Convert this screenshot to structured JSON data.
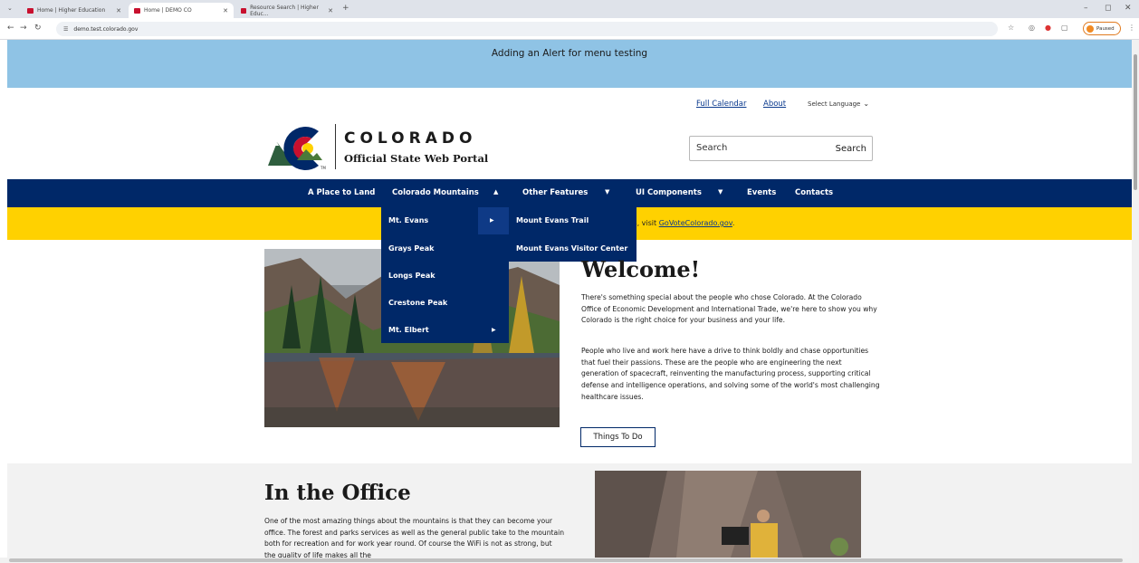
{
  "browser": {
    "tabs": [
      {
        "title": "Home | Higher Education"
      },
      {
        "title": "Home | DEMO CO"
      },
      {
        "title": "Resource Search | Higher Educ..."
      }
    ],
    "url": "demo.test.colorado.gov",
    "profile_label": "Paused",
    "icons": {
      "back": "back-arrow-icon",
      "forward": "forward-arrow-icon",
      "reload": "reload-icon",
      "star": "bookmark-star-icon",
      "menu": "kebab-menu-icon"
    }
  },
  "alert": {
    "text": "Adding an Alert for menu testing"
  },
  "header": {
    "links": {
      "calendar": "Full Calendar",
      "about": "About"
    },
    "language": "Select Language",
    "brand": "COLORADO",
    "tagline": "Official State Web Portal",
    "search_placeholder": "Search",
    "search_button": "Search"
  },
  "nav": {
    "items": [
      "A Place to Land",
      "Colorado Mountains",
      "Other Features",
      "UI Components",
      "Events",
      "Contacts"
    ]
  },
  "banner": {
    "text": "ults, visit ",
    "link": "GoVoteColorado.gov",
    "end": "."
  },
  "dropdown": {
    "items": [
      "Mt. Evans",
      "Grays Peak",
      "Longs Peak",
      "Crestone Peak",
      "Mt. Elbert"
    ],
    "submenu": [
      "Mount Evans Trail",
      "Mount Evans Visitor Center"
    ]
  },
  "welcome": {
    "title": "Welcome!",
    "p1": "There's something special about the people who chose Colorado. At the Colorado Office of Economic Development and International Trade, we're here to show you why Colorado is the right choice for your business and your life.",
    "p2": "People who live and work here have a drive to think boldly and chase opportunities that fuel their passions. These are the people who are engineering the next generation of spacecraft, reinventing the manufacturing process, supporting critical defense and intelligence operations, and solving some of the world's most challenging healthcare issues.",
    "button": "Things To Do"
  },
  "office": {
    "title": "In the Office",
    "p1": "One of the most amazing things about the mountains is that they can become your office. The forest and parks services as well as the general public take to the mountain both for recreation and for work year round. Of course the WiFi is not as strong, but the quality of life makes all the"
  },
  "colors": {
    "navy": "#002868",
    "alert_blue": "#8fc3e5",
    "banner_yellow": "#ffd100",
    "link_blue": "#0b3a8e"
  }
}
